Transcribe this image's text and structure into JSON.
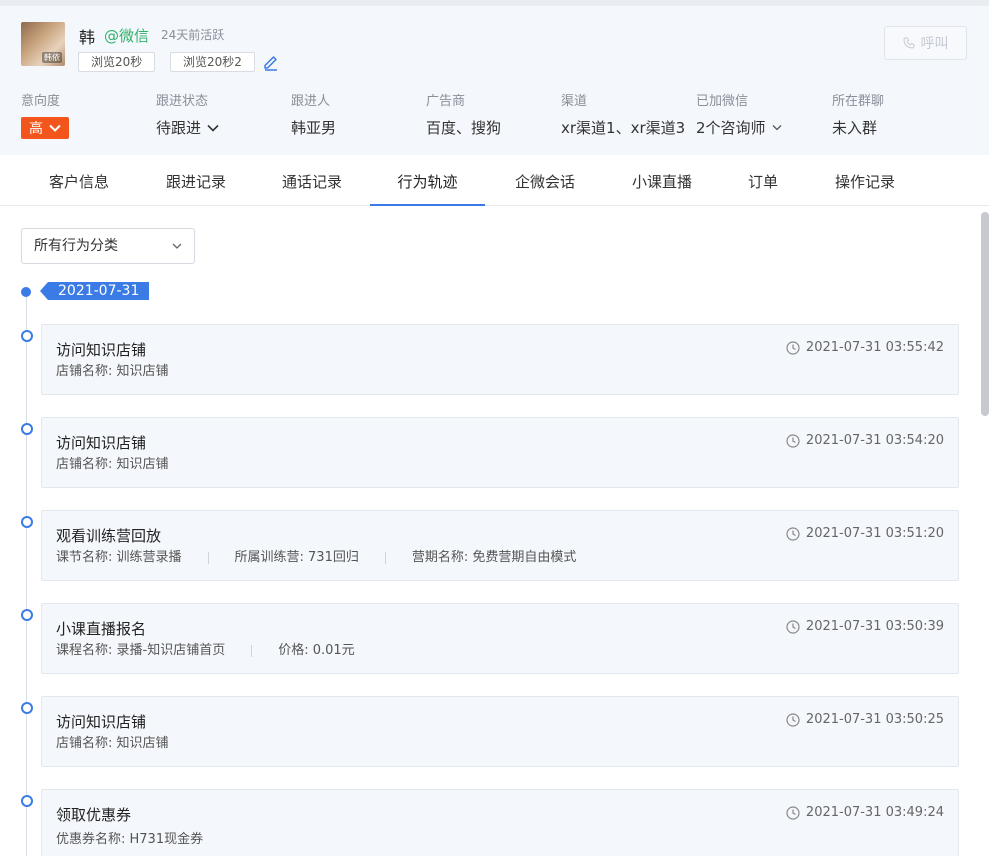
{
  "profile": {
    "name": "韩",
    "source": "@微信",
    "last_active": "24天前活跃",
    "avatar_tag": "韩依",
    "tags": [
      "浏览20秒",
      "浏览20秒2"
    ],
    "call_label": "呼叫"
  },
  "fields": [
    {
      "label": "意向度",
      "value": "高"
    },
    {
      "label": "跟进状态",
      "value": "待跟进"
    },
    {
      "label": "跟进人",
      "value": "韩亚男"
    },
    {
      "label": "广告商",
      "value": "百度、搜狗"
    },
    {
      "label": "渠道",
      "value": "xr渠道1、xr渠道3"
    },
    {
      "label": "已加微信",
      "value": "2个咨询师"
    },
    {
      "label": "所在群聊",
      "value": "未入群"
    }
  ],
  "tabs": [
    "客户信息",
    "跟进记录",
    "通话记录",
    "行为轨迹",
    "企微会话",
    "小课直播",
    "订单",
    "操作记录"
  ],
  "active_tab": "行为轨迹",
  "filter": {
    "value": "所有行为分类"
  },
  "timeline": {
    "date": "2021-07-31",
    "events": [
      {
        "title": "访问知识店铺",
        "meta": [
          "店铺名称: 知识店铺"
        ],
        "time": "2021-07-31 03:55:42"
      },
      {
        "title": "访问知识店铺",
        "meta": [
          "店铺名称: 知识店铺"
        ],
        "time": "2021-07-31 03:54:20"
      },
      {
        "title": "观看训练营回放",
        "meta": [
          "课节名称: 训练营录播",
          "所属训练营: 731回归",
          "营期名称: 免费营期自由模式"
        ],
        "time": "2021-07-31 03:51:20"
      },
      {
        "title": "小课直播报名",
        "meta": [
          "课程名称: 录播-知识店铺首页",
          "价格: 0.01元"
        ],
        "time": "2021-07-31 03:50:39"
      },
      {
        "title": "访问知识店铺",
        "meta": [
          "店铺名称: 知识店铺"
        ],
        "time": "2021-07-31 03:50:25"
      },
      {
        "title": "领取优惠券",
        "meta": [
          "优惠券名称: H731现金券"
        ],
        "time": "2021-07-31 03:49:24"
      }
    ]
  },
  "colors": {
    "accent": "#3a7be6",
    "badge": "#f2561d",
    "wechat": "#2fb36a"
  }
}
